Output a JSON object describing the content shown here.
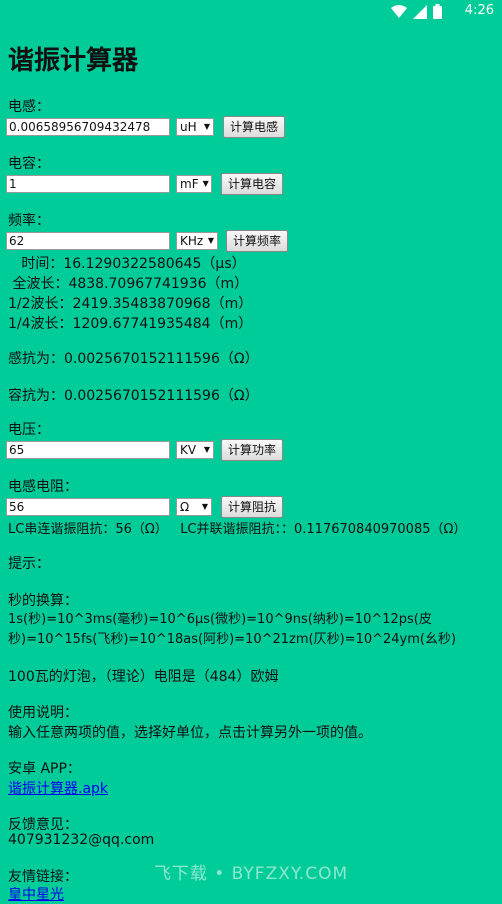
{
  "status_bar": {
    "time": "4:26",
    "icons": [
      "wifi-icon",
      "signal-icon",
      "battery-icon"
    ]
  },
  "title": "谐振计算器",
  "inductance": {
    "label": "电感：",
    "value": "0.00658956709432478",
    "unit": "uH",
    "button": "计算电感"
  },
  "capacitance": {
    "label": "电容：",
    "value": "1",
    "unit": "mF",
    "button": "计算电容"
  },
  "frequency": {
    "label": "频率：",
    "value": "62",
    "unit": "KHz",
    "button": "计算频率"
  },
  "results": {
    "time": "   时间：16.1290322580645（μs）",
    "full_wave": " 全波长：4838.70967741936（m）",
    "half_wave": "1/2波长：2419.35483870968（m）",
    "quarter_wave": "1/4波长：1209.67741935484（m）",
    "inductive_reactance": "感抗为：0.0025670152111596（Ω）",
    "capacitive_reactance": "容抗为：0.0025670152111596（Ω）"
  },
  "voltage": {
    "label": "电压：",
    "value": "65",
    "unit": "KV",
    "button": "计算功率"
  },
  "resistance": {
    "label": "电感电阻：",
    "value": "56",
    "unit": "Ω",
    "button": "计算阻抗"
  },
  "impedance_result": "LC串连谐振阻抗：56（Ω）   LC并联谐振阻抗：：0.117670840970085（Ω）",
  "tips": {
    "heading": "提示：",
    "seconds_heading": "秒的换算：",
    "seconds_text": "1s(秒)=10^3ms(毫秒)=10^6μs(微秒)=10^9ns(纳秒)=10^12ps(皮秒)=10^15fs(飞秒)=10^18as(阿秒)=10^21zm(仄秒)=10^24ym(幺秒)",
    "bulb_text": "100瓦的灯泡，（理论）电阻是（484）欧姆",
    "usage_heading": "使用说明：",
    "usage_text": "输入任意两项的值，选择好单位，点击计算另外一项的值。",
    "android_heading": "安卓 APP：",
    "apk_link": "谐振计算器.apk",
    "feedback_heading": "反馈意见：",
    "feedback_email": "407931232@qq.com",
    "friend_links_heading": "友情链接：",
    "friend_link": "皇中星光"
  },
  "watermark": "飞下载 • BYFZXY.COM"
}
